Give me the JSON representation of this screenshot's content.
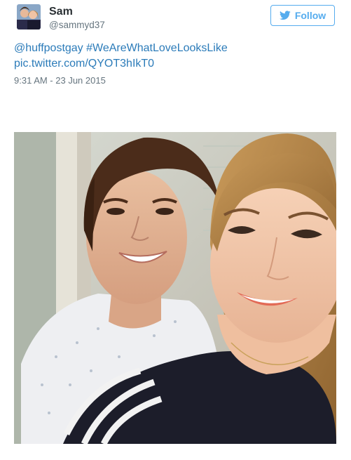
{
  "user": {
    "display_name": "Sam",
    "screen_name": "@sammyd37",
    "avatar_icon": "profile-photo"
  },
  "follow_button": {
    "label": "Follow",
    "icon": "twitter-bird-icon",
    "color": "#55acee"
  },
  "tweet": {
    "mention": "@huffpostgay",
    "hashtag": "#WeAreWhatLoveLooksLike",
    "link": "pic.twitter.com/QYOT3hIkT0",
    "link_color": "#2b7bb9",
    "timestamp": "9:31 AM - 23 Jun 2015"
  },
  "media": {
    "type": "selfie-photo"
  }
}
